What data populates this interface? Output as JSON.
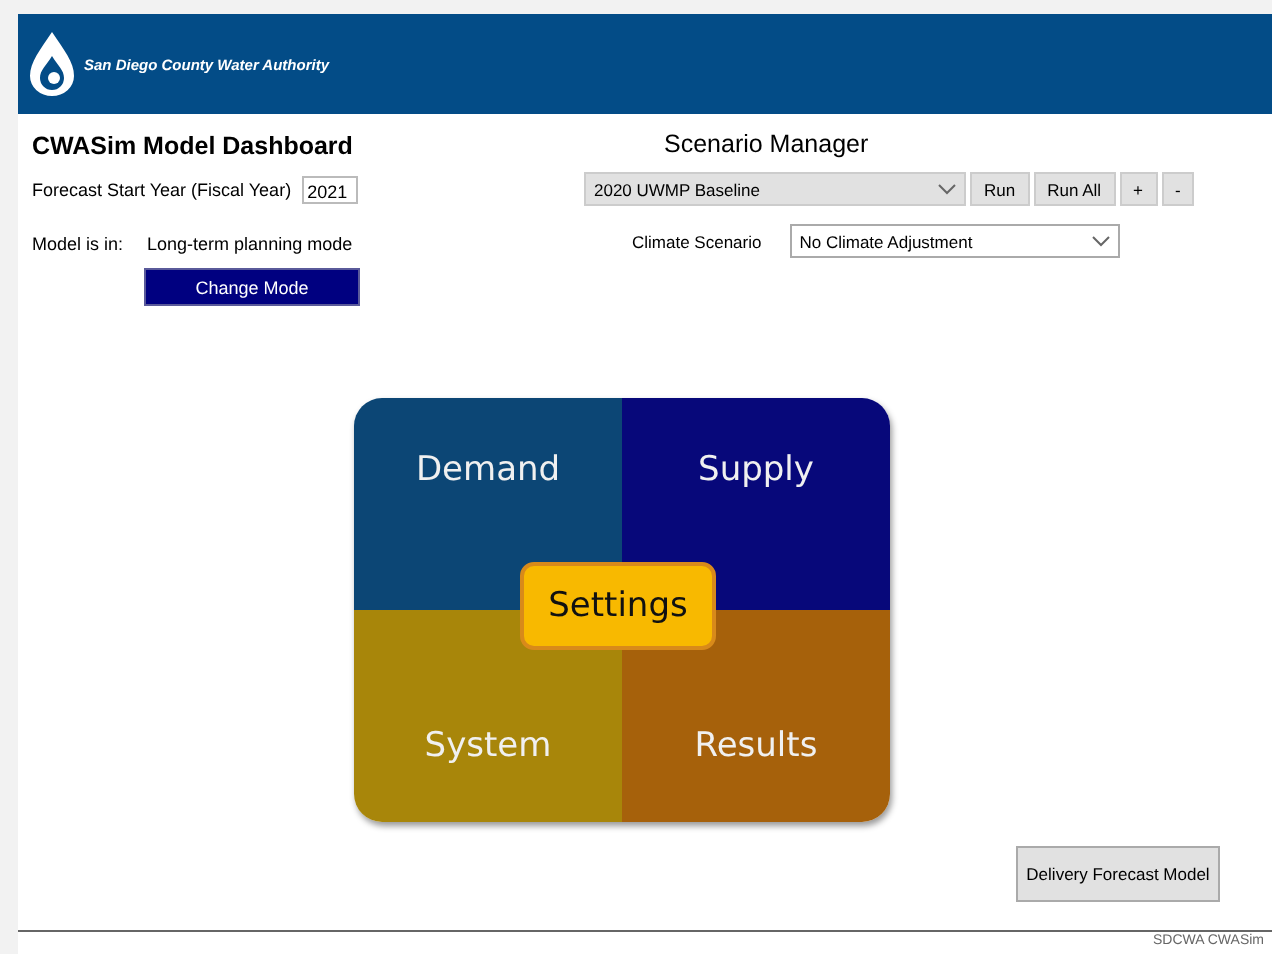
{
  "header": {
    "organization": "San Diego County Water Authority"
  },
  "dashboard": {
    "title": "CWASim Model Dashboard",
    "forecast_start": {
      "label": "Forecast Start Year (Fiscal Year)",
      "value": "2021"
    },
    "mode": {
      "label": "Model is in:",
      "value": "Long-term planning mode"
    },
    "change_mode_button": "Change Mode"
  },
  "scenario_manager": {
    "title": "Scenario Manager",
    "scenario": "2020 UWMP Baseline",
    "buttons": [
      "Run",
      "Run All",
      "+",
      "-"
    ],
    "climate": {
      "label": "Climate Scenario",
      "value": "No Climate Adjustment"
    }
  },
  "tiles": [
    {
      "label": "Demand",
      "color": "#0c4675"
    },
    {
      "label": "Supply",
      "color": "#07087a"
    },
    {
      "label": "System",
      "color": "#a8860a"
    },
    {
      "label": "Results",
      "color": "#a6610b"
    }
  ],
  "settings_button": "Settings",
  "delivery_button": "Delivery Forecast Model",
  "footer": "SDCWA CWASim"
}
